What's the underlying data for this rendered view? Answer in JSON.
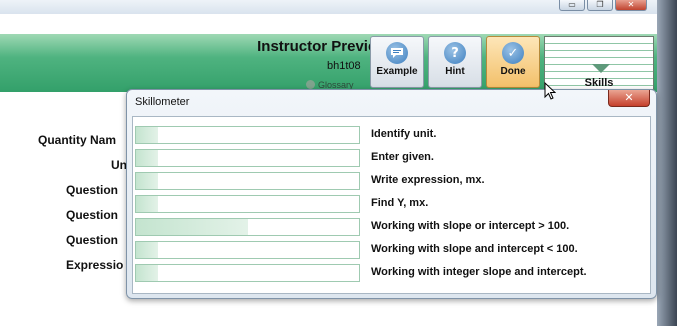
{
  "window": {
    "minimize_label": "▭",
    "restore_label": "❐",
    "close_label": "✕"
  },
  "header": {
    "title": "Instructor Preview",
    "problem_name": "bh1t08",
    "glossary_label": "Glossary",
    "buttons": {
      "example": "Example",
      "hint": "Hint",
      "done": "Done",
      "skills": "Skills"
    },
    "icons": {
      "example": "speech-bubble-icon",
      "hint": "question-mark-icon",
      "done": "checkmark-icon",
      "skills": "down-arrow-icon"
    }
  },
  "form": {
    "labels": [
      "Quantity Nam",
      "Un",
      "Question",
      "Question",
      "Question",
      "Expressio"
    ]
  },
  "skillometer": {
    "title": "Skillometer",
    "close_label": "✕",
    "skills": [
      {
        "name": "Identify unit.",
        "mastery": 0.1
      },
      {
        "name": "Enter given.",
        "mastery": 0.1
      },
      {
        "name": "Write expression, mx.",
        "mastery": 0.1
      },
      {
        "name": "Find Y, mx.",
        "mastery": 0.1
      },
      {
        "name": "Working with slope or intercept > 100.",
        "mastery": 0.5
      },
      {
        "name": "Working with slope and intercept < 100.",
        "mastery": 0.1
      },
      {
        "name": "Working with integer slope and intercept.",
        "mastery": 0.1
      }
    ]
  },
  "colors": {
    "header_green": "#33a06a",
    "bar_fill": "#c4e4cf",
    "bar_border": "#9fcab1",
    "close_red": "#c5402c"
  }
}
